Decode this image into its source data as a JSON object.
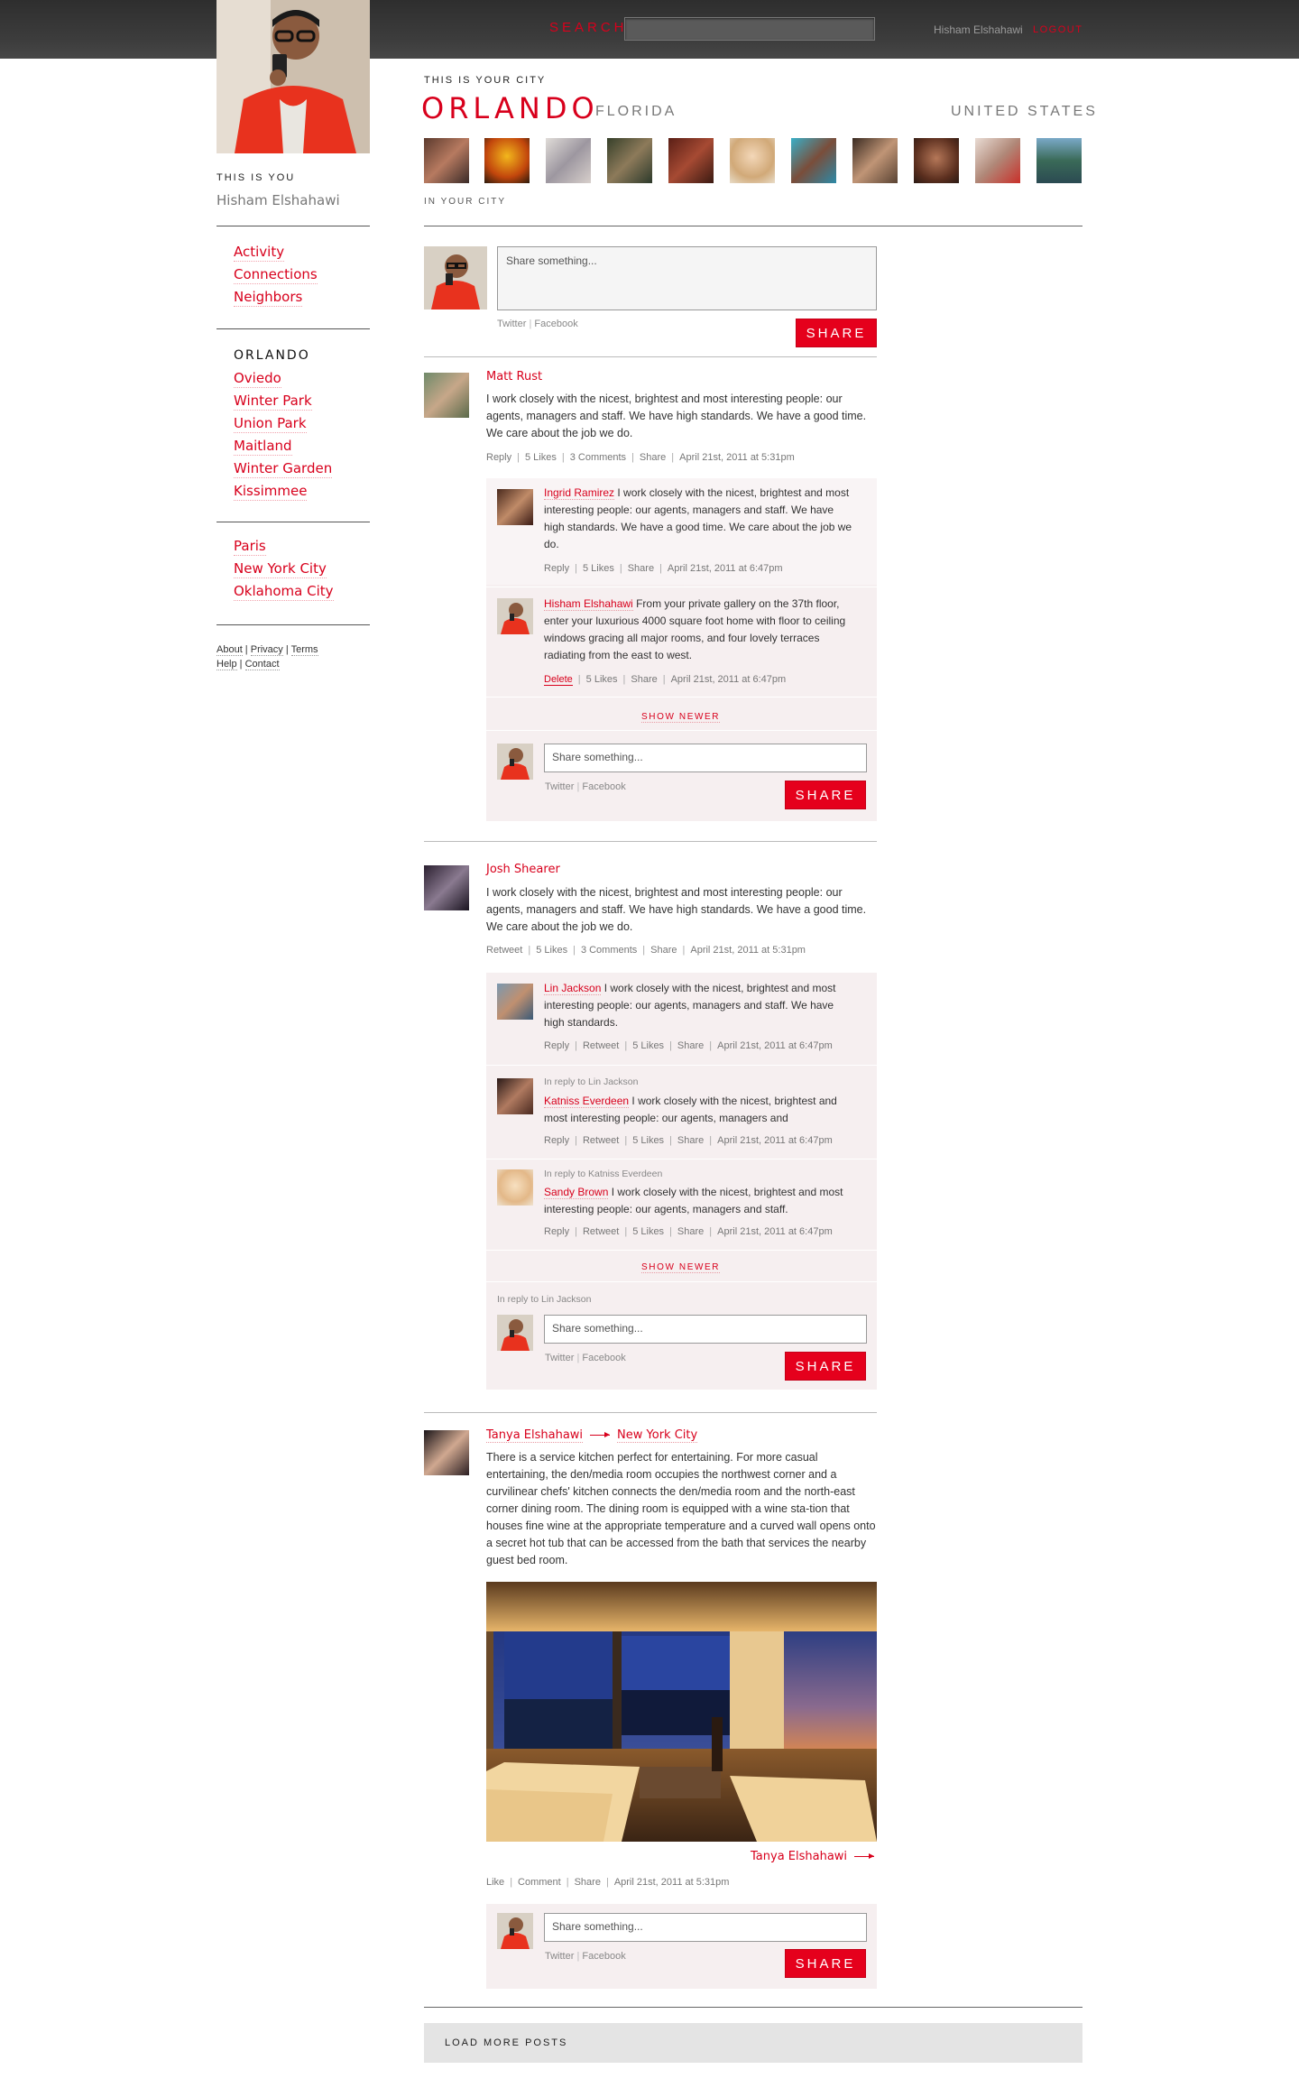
{
  "header": {
    "search_label": "SEARCH",
    "user_name": "Hisham Elshahawi",
    "logout": "LOGOUT"
  },
  "profile": {
    "caption": "THIS IS YOU",
    "name": "Hisham Elshahawi"
  },
  "city": {
    "caption": "THIS IS YOUR CITY",
    "name": "ORLANDO",
    "state": "FLORIDA",
    "country": "UNITED STATES",
    "people_caption": "IN YOUR CITY"
  },
  "sidebar": {
    "nav": [
      "Activity",
      "Connections",
      "Neighbors"
    ],
    "current_city": "ORLANDO",
    "nearby": [
      "Oviedo",
      "Winter Park",
      "Union Park",
      "Maitland",
      "Winter Garden",
      "Kissimmee"
    ],
    "other_cities": [
      "Paris",
      "New York City",
      "Oklahoma City"
    ],
    "footer": {
      "about": "About",
      "privacy": "Privacy",
      "terms": "Terms",
      "help": "Help",
      "contact": "Contact"
    }
  },
  "composer": {
    "placeholder": "Share something...",
    "twitter": "Twitter",
    "facebook": "Facebook",
    "share": "SHARE"
  },
  "common": {
    "reply": "Reply",
    "retweet": "Retweet",
    "share": "Share",
    "delete": "Delete",
    "like": "Like",
    "comment": "Comment",
    "show_newer": "SHOW NEWER",
    "placeholder": "Share something...",
    "twitter": "Twitter",
    "facebook": "Facebook",
    "share_btn": "SHARE",
    "sep": "|"
  },
  "posts": [
    {
      "author": "Matt Rust",
      "text": "I work closely with the nicest, brightest and most interesting people: our agents, managers and staff. We have high standards. We have a good time. We care about the job we do.",
      "likes": "5 Likes",
      "comments": "3 Comments",
      "date": "April 21st, 2011 at 5:31pm",
      "replies": [
        {
          "author": "Ingrid Ramirez",
          "text": "I work closely with the nicest, brightest and most interesting people: our agents, managers and staff. We have high standards. We have a good time. We care about the job we do.",
          "likes": "5 Likes",
          "date": "April 21st, 2011 at 6:47pm"
        },
        {
          "author": "Hisham Elshahawi",
          "text": "From your private gallery on the 37th floor, enter your luxurious 4000 square foot home with floor to ceiling windows gracing all major rooms, and four lovely terraces radiating from the east to west.",
          "likes": "5 Likes",
          "date": "April 21st, 2011 at 6:47pm"
        }
      ]
    },
    {
      "author": "Josh Shearer",
      "text": "I work closely with the nicest, brightest and most interesting people: our agents, managers and staff. We have high standards. We have a good time. We care about the job we do.",
      "likes": "5 Likes",
      "comments": "3 Comments",
      "date": "April 21st, 2011 at 5:31pm",
      "replies": [
        {
          "author": "Lin Jackson",
          "text": "I work closely with the nicest, brightest and most interesting people: our agents, managers and staff. We have high standards.",
          "likes": "5 Likes",
          "date": "April 21st, 2011 at 6:47pm"
        },
        {
          "in_reply": "In reply to Lin Jackson",
          "author": "Katniss Everdeen",
          "text": "I work closely with the nicest, brightest and most interesting people: our agents, managers and",
          "likes": "5 Likes",
          "date": "April 21st, 2011 at 6:47pm"
        },
        {
          "in_reply": "In reply to Katniss Everdeen",
          "author": "Sandy Brown",
          "text": "I work closely with the nicest, brightest and most interesting people: our agents, managers and staff.",
          "likes": "5 Likes",
          "date": "April 21st, 2011 at 6:47pm"
        }
      ],
      "composer_reply": "In reply to Lin Jackson"
    },
    {
      "author": "Tanya Elshahawi",
      "target": "New York City",
      "text": "There is a service kitchen perfect for entertaining. For more casual entertaining, the den/media room occupies the northwest corner and a curvilinear chefs' kitchen connects the den/media room and the north-east corner dining room. The dining room is equipped with a wine sta-tion that houses fine wine at the appropriate temperature and a curved wall opens onto a secret hot tub that can be accessed from the bath that services the nearby guest bed room.",
      "photo_credit": "Tanya Elshahawi",
      "date": "April 21st, 2011 at 5:31pm"
    }
  ],
  "load_more": "LOAD MORE POSTS"
}
